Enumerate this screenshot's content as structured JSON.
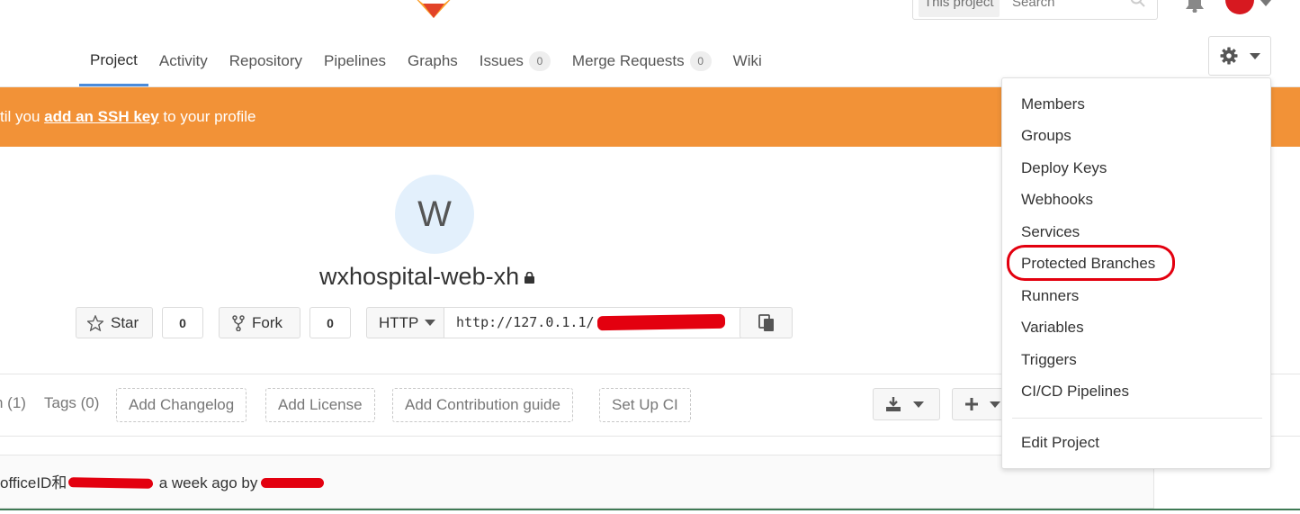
{
  "header": {
    "search_scope": "This project",
    "search_placeholder": "Search"
  },
  "nav": {
    "tabs": [
      {
        "label": "Project",
        "active": true
      },
      {
        "label": "Activity"
      },
      {
        "label": "Repository"
      },
      {
        "label": "Pipelines"
      },
      {
        "label": "Graphs"
      },
      {
        "label": "Issues",
        "count": "0"
      },
      {
        "label": "Merge Requests",
        "count": "0"
      },
      {
        "label": "Wiki"
      }
    ]
  },
  "flash": {
    "prefix": "til you ",
    "link": "add an SSH key",
    "suffix": " to your profile"
  },
  "project": {
    "avatar_letter": "W",
    "name": "wxhospital-web-xh",
    "star_label": "Star",
    "star_count": "0",
    "fork_label": "Fork",
    "fork_count": "0",
    "protocol": "HTTP",
    "clone_url": "http://127.0.1.1/"
  },
  "repo_bar": {
    "branches": "h (1)",
    "tags": "Tags (0)",
    "actions": [
      "Add Changelog",
      "Add License",
      "Add Contribution guide",
      "Set Up CI"
    ]
  },
  "commit": {
    "prefix": "officeID和",
    "middle": "· a week ago by"
  },
  "settings_menu": {
    "items": [
      "Members",
      "Groups",
      "Deploy Keys",
      "Webhooks",
      "Services",
      "Protected Branches",
      "Runners",
      "Variables",
      "Triggers",
      "CI/CD Pipelines"
    ],
    "footer_item": "Edit Project",
    "highlighted": "Protected Branches"
  },
  "colors": {
    "flash_bg": "#f29237",
    "active_tab_underline": "#4a8bdb",
    "annotation_red": "#e3000f"
  }
}
